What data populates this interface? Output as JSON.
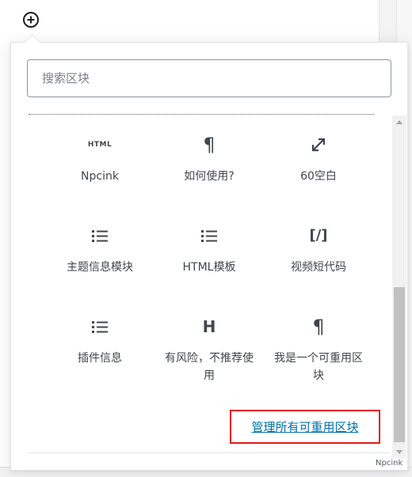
{
  "search": {
    "placeholder": "搜索区块"
  },
  "blocks": [
    {
      "icon": "html-icon",
      "label": "Npcink"
    },
    {
      "icon": "paragraph-icon",
      "label": "如何使用?"
    },
    {
      "icon": "expand-arrows-icon",
      "label": "60空白"
    },
    {
      "icon": "list-icon",
      "label": "主题信息模块"
    },
    {
      "icon": "list-icon",
      "label": "HTML模板"
    },
    {
      "icon": "shortcode-icon",
      "label": "视频短代码"
    },
    {
      "icon": "list-icon",
      "label": "插件信息"
    },
    {
      "icon": "heading-icon",
      "label": "有风险，不推荐使用"
    },
    {
      "icon": "paragraph-icon",
      "label": "我是一个可重用区块"
    }
  ],
  "icons": {
    "html_text": "HTML",
    "paragraph_glyph": "¶",
    "heading_glyph": "H",
    "shortcode_glyph": "[/]"
  },
  "manage_link": "管理所有可重用区块",
  "footer": {
    "text": "Npcink"
  },
  "colors": {
    "link": "#0073aa",
    "highlight_border": "#e21a1a"
  }
}
